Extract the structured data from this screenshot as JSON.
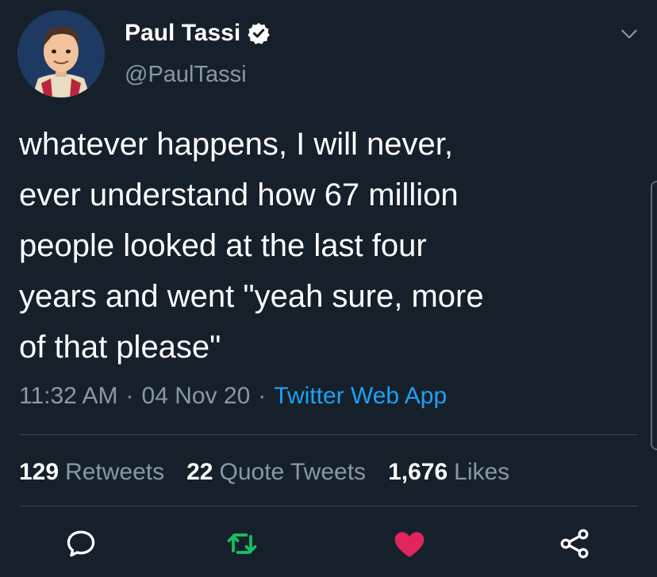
{
  "author": {
    "name": "Paul Tassi",
    "handle": "@PaulTassi",
    "avatar_icon": "avatar-illustration"
  },
  "tweet": {
    "text": "whatever happens, I will never,\never understand how 67 million\npeople looked at the last four\nyears and went \"yeah sure, more\nof that please\"",
    "time": "11:32 AM",
    "date": "04 Nov 20",
    "separator": "·",
    "source": "Twitter Web App"
  },
  "stats": {
    "retweets_count": "129",
    "retweets_label": "Retweets",
    "quote_count": "22",
    "quote_label": "Quote Tweets",
    "likes_count": "1,676",
    "likes_label": "Likes"
  },
  "actions": {
    "reply_icon": "reply-icon",
    "retweet_icon": "retweet-icon",
    "like_icon": "heart-icon",
    "share_icon": "share-icon"
  },
  "colors": {
    "background": "#15202b",
    "secondary_text": "#8899a6",
    "link": "#1da1f2",
    "retweet": "#17bf63",
    "like": "#e0245e",
    "verified": "#ffffff"
  }
}
